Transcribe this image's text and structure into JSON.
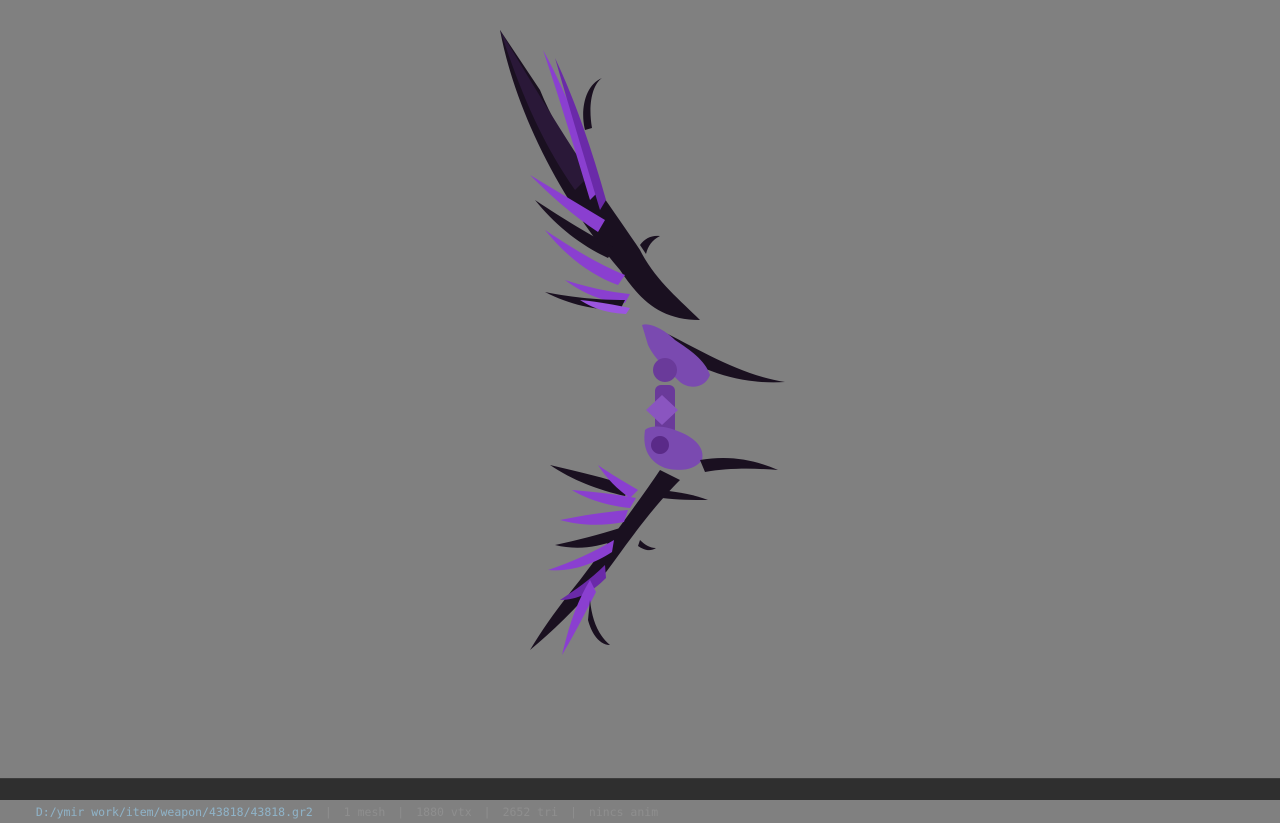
{
  "viewer": {
    "model_icon": "purple-winged-bow-model",
    "background_color": "#808080"
  },
  "status": {
    "file_path": "D:/ymir work/item/weapon/43818/43818.gr2",
    "separator": "|",
    "mesh_count": "1 mesh",
    "vertex_count": "1880 vtx",
    "triangle_count": "2652 tri",
    "anim_status": "nincs anim"
  },
  "colors": {
    "feather_purple": "#8a3fd0",
    "feather_dark": "#1a1020",
    "grip_purple": "#7a4ab0",
    "status_bg": "#2f2f2f",
    "path_text": "#8fb3c8"
  }
}
